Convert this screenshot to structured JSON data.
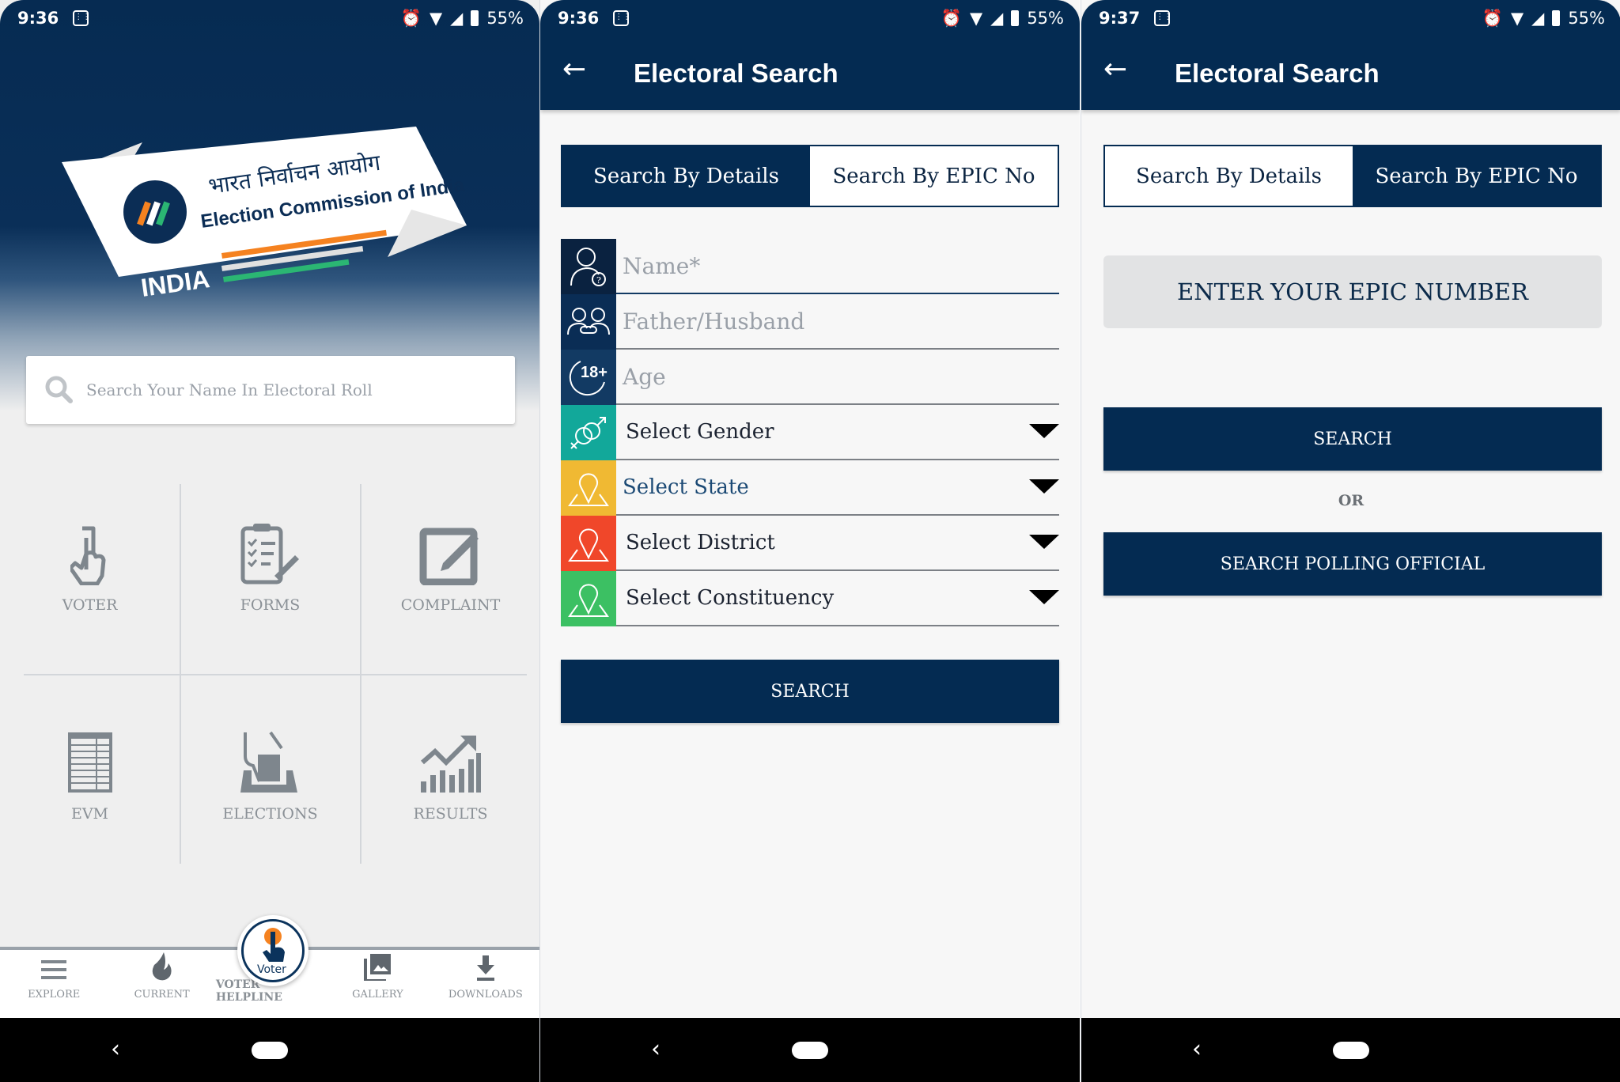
{
  "screens": [
    {
      "status": {
        "time": "9:36",
        "battery": "55%"
      },
      "logo": {
        "hindi": "भारत निर्वाचन आयोग",
        "english": "Election Commission of India",
        "country": "INDIA"
      },
      "search": {
        "placeholder": "Search Your Name In Electoral Roll"
      },
      "grid": [
        {
          "label": "VOTER",
          "icon": "touch-hand-icon"
        },
        {
          "label": "FORMS",
          "icon": "clipboard-icon"
        },
        {
          "label": "COMPLAINT",
          "icon": "edit-icon"
        },
        {
          "label": "EVM",
          "icon": "evm-machine-icon"
        },
        {
          "label": "ELECTIONS",
          "icon": "ballot-box-icon"
        },
        {
          "label": "RESULTS",
          "icon": "chart-growth-icon"
        }
      ],
      "bottom_nav": [
        {
          "label": "EXPLORE",
          "icon": "menu-icon"
        },
        {
          "label": "CURRENT",
          "icon": "flame-icon"
        },
        {
          "label": "VOTER HELPLINE",
          "icon": "voter-logo-icon"
        },
        {
          "label": "GALLERY",
          "icon": "gallery-icon"
        },
        {
          "label": "DOWNLOADS",
          "icon": "download-icon"
        }
      ],
      "fab_text": "Voter"
    },
    {
      "status": {
        "time": "9:36",
        "battery": "55%"
      },
      "title": "Electoral Search",
      "tabs": [
        {
          "label": "Search By Details",
          "active": true
        },
        {
          "label": "Search By EPIC No",
          "active": false
        }
      ],
      "fields": [
        {
          "placeholder": "Name*",
          "type": "text",
          "icon": "person-question-icon",
          "color": "#0a2240"
        },
        {
          "placeholder": "Father/Husband",
          "type": "text",
          "icon": "relation-icon",
          "color": "#0a2d55"
        },
        {
          "placeholder": "Age",
          "type": "text",
          "icon": "age-18-plus-icon",
          "color": "#123a63"
        },
        {
          "value": "Select Gender",
          "type": "select",
          "icon": "gender-icon",
          "color": "#12a89a"
        },
        {
          "value": "Select State",
          "type": "select",
          "icon": "map-pin-icon",
          "color": "#f0b933"
        },
        {
          "value": "Select District",
          "type": "select",
          "icon": "map-pin-icon",
          "color": "#f0472a"
        },
        {
          "value": "Select Constituency",
          "type": "select",
          "icon": "map-pin-icon",
          "color": "#3cc063"
        }
      ],
      "search_button": "SEARCH"
    },
    {
      "status": {
        "time": "9:37",
        "battery": "55%"
      },
      "title": "Electoral Search",
      "tabs": [
        {
          "label": "Search By Details",
          "active": false
        },
        {
          "label": "Search By EPIC No",
          "active": true
        }
      ],
      "epic_placeholder": "ENTER YOUR EPIC NUMBER",
      "search_button": "SEARCH",
      "or_text": "OR",
      "polling_button": "SEARCH POLLING OFFICIAL"
    }
  ],
  "colors": {
    "primary": "#042b52",
    "background": "#f7f7f7",
    "saffron": "#f58220",
    "green": "#2bb673"
  }
}
